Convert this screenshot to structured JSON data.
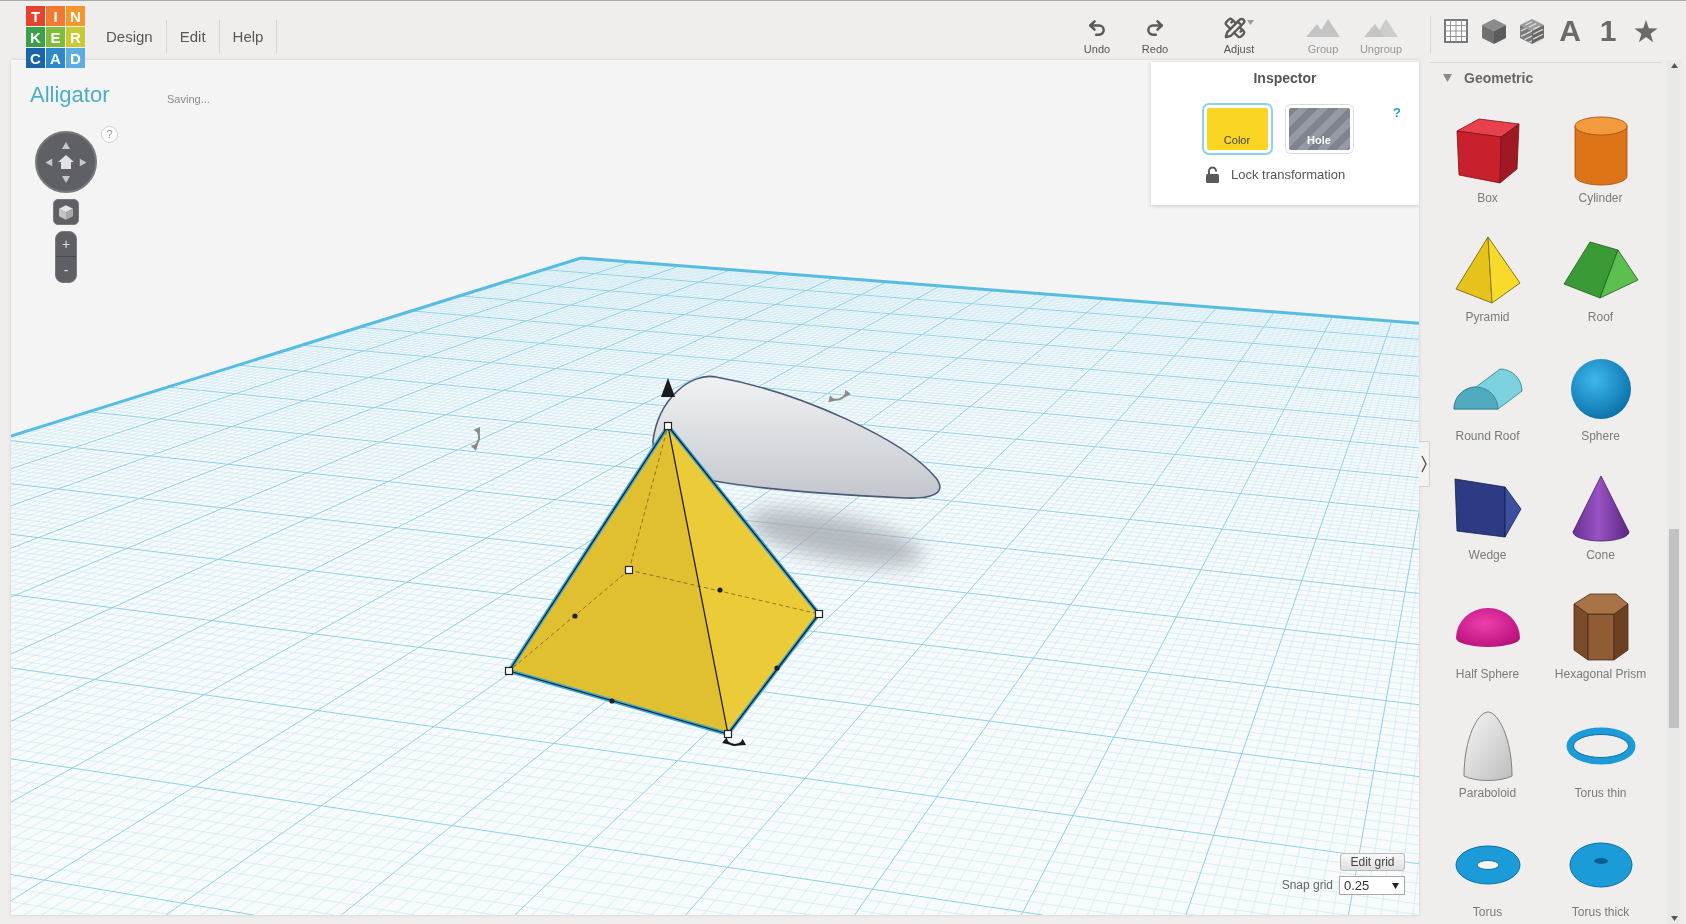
{
  "logo": {
    "letters": [
      {
        "char": "T",
        "color": "#e5432d"
      },
      {
        "char": "I",
        "color": "#f27a30"
      },
      {
        "char": "N",
        "color": "#f4982e"
      },
      {
        "char": "K",
        "color": "#3aa14a"
      },
      {
        "char": "E",
        "color": "#7fbb3c"
      },
      {
        "char": "R",
        "color": "#c7cb33"
      },
      {
        "char": "C",
        "color": "#1a64a9"
      },
      {
        "char": "A",
        "color": "#2d89c8"
      },
      {
        "char": "D",
        "color": "#5dade0"
      }
    ]
  },
  "menu": [
    "Design",
    "Edit",
    "Help"
  ],
  "toolbar": [
    {
      "kind": "undo",
      "label": "Undo",
      "disabled": false,
      "menu": false
    },
    {
      "kind": "redo",
      "label": "Redo",
      "disabled": false,
      "menu": false
    },
    {
      "kind": "adjust",
      "label": "Adjust",
      "disabled": false,
      "menu": true
    },
    {
      "kind": "group",
      "label": "Group",
      "disabled": true,
      "menu": false
    },
    {
      "kind": "ungroup",
      "label": "Ungroup",
      "disabled": true,
      "menu": false
    }
  ],
  "categories": [
    {
      "kind": "grid"
    },
    {
      "kind": "cube"
    },
    {
      "kind": "striped-cube"
    },
    {
      "kind": "letter",
      "label": "A"
    },
    {
      "kind": "letter",
      "label": "1"
    },
    {
      "kind": "star"
    }
  ],
  "workspace": {
    "title": "Alligator",
    "status": "Saving...",
    "view_help": "?",
    "zoom_in": "+",
    "zoom_out": "-"
  },
  "inspector": {
    "title": "Inspector",
    "help": "?",
    "options": [
      {
        "kind": "solid",
        "label": "Color",
        "color": "#fbd523",
        "selected": true
      },
      {
        "kind": "hole",
        "label": "Hole",
        "selected": false
      }
    ],
    "lock": {
      "label": "Lock transformation",
      "locked": false
    }
  },
  "grid_controls": {
    "edit_button": "Edit grid",
    "snap_label": "Snap grid",
    "snap_value": "0.25"
  },
  "sidebar": {
    "section": {
      "title": "Geometric",
      "expanded": true
    },
    "shapes": [
      {
        "kind": "box",
        "label": "Box"
      },
      {
        "kind": "cylinder",
        "label": "Cylinder"
      },
      {
        "kind": "pyramid",
        "label": "Pyramid"
      },
      {
        "kind": "roof",
        "label": "Roof"
      },
      {
        "kind": "round-roof",
        "label": "Round Roof"
      },
      {
        "kind": "sphere",
        "label": "Sphere"
      },
      {
        "kind": "wedge",
        "label": "Wedge"
      },
      {
        "kind": "cone",
        "label": "Cone"
      },
      {
        "kind": "half-sphere",
        "label": "Half Sphere"
      },
      {
        "kind": "hexagonal-prism",
        "label": "Hexagonal Prism"
      },
      {
        "kind": "paraboloid",
        "label": "Paraboloid"
      },
      {
        "kind": "torus-thin",
        "label": "Torus thin"
      },
      {
        "kind": "torus",
        "label": "Torus"
      },
      {
        "kind": "torus-thick",
        "label": "Torus thick"
      }
    ]
  }
}
